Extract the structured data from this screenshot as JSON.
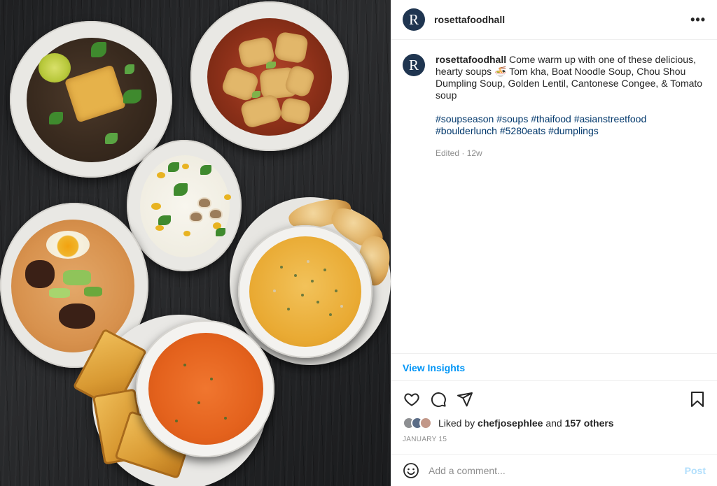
{
  "post": {
    "username": "rosettafoodhall",
    "avatar_letter": "R",
    "more_icon": "more-horizontal-icon"
  },
  "caption": {
    "username": "rosettafoodhall",
    "text": "Come warm up with one of these delicious, hearty soups",
    "emoji": "🍜",
    "text2": "Tom kha, Boat Noodle Soup, Chou Shou Dumpling Soup, Golden Lentil, Cantonese Congee, & Tomato soup",
    "hashtags": [
      "#soupseason",
      "#soups",
      "#thaifood",
      "#asianstreetfood",
      "#boulderlunch",
      "#5280eats",
      "#dumplings"
    ],
    "edited": "Edited · 12w"
  },
  "insights": {
    "label": "View Insights"
  },
  "actions": {
    "like_icon": "heart-icon",
    "comment_icon": "comment-icon",
    "share_icon": "send-icon",
    "save_icon": "bookmark-icon"
  },
  "likes": {
    "prefix": "Liked by",
    "user": "chefjosephlee",
    "joiner": "and",
    "others": "157 others"
  },
  "date": "JANUARY 15",
  "comment_box": {
    "placeholder": "Add a comment...",
    "post_label": "Post",
    "emoji_icon": "emoji-smile-icon"
  },
  "colors": {
    "brand_avatar": "#1f3550",
    "link_blue": "#0095f6",
    "hashtag_blue": "#00376b",
    "muted": "#8e8e8e"
  }
}
